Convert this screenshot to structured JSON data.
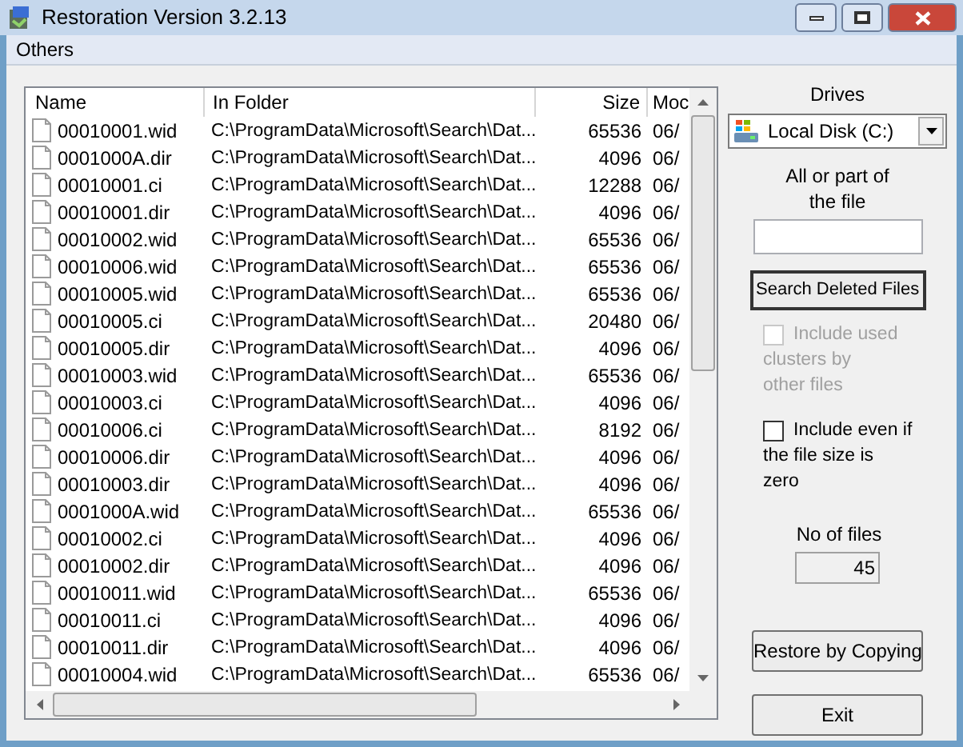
{
  "window": {
    "title": "Restoration Version 3.2.13"
  },
  "menu": [
    {
      "label": "Others"
    }
  ],
  "table": {
    "columns": [
      "Name",
      "In Folder",
      "Size",
      "Moc"
    ],
    "rows": [
      {
        "name": "00010001.wid",
        "folder": "C:\\ProgramData\\Microsoft\\Search\\Dat...",
        "size": "65536",
        "modified": "06/"
      },
      {
        "name": "0001000A.dir",
        "folder": "C:\\ProgramData\\Microsoft\\Search\\Dat...",
        "size": "4096",
        "modified": "06/"
      },
      {
        "name": "00010001.ci",
        "folder": "C:\\ProgramData\\Microsoft\\Search\\Dat...",
        "size": "12288",
        "modified": "06/"
      },
      {
        "name": "00010001.dir",
        "folder": "C:\\ProgramData\\Microsoft\\Search\\Dat...",
        "size": "4096",
        "modified": "06/"
      },
      {
        "name": "00010002.wid",
        "folder": "C:\\ProgramData\\Microsoft\\Search\\Dat...",
        "size": "65536",
        "modified": "06/"
      },
      {
        "name": "00010006.wid",
        "folder": "C:\\ProgramData\\Microsoft\\Search\\Dat...",
        "size": "65536",
        "modified": "06/"
      },
      {
        "name": "00010005.wid",
        "folder": "C:\\ProgramData\\Microsoft\\Search\\Dat...",
        "size": "65536",
        "modified": "06/"
      },
      {
        "name": "00010005.ci",
        "folder": "C:\\ProgramData\\Microsoft\\Search\\Dat...",
        "size": "20480",
        "modified": "06/"
      },
      {
        "name": "00010005.dir",
        "folder": "C:\\ProgramData\\Microsoft\\Search\\Dat...",
        "size": "4096",
        "modified": "06/"
      },
      {
        "name": "00010003.wid",
        "folder": "C:\\ProgramData\\Microsoft\\Search\\Dat...",
        "size": "65536",
        "modified": "06/"
      },
      {
        "name": "00010003.ci",
        "folder": "C:\\ProgramData\\Microsoft\\Search\\Dat...",
        "size": "4096",
        "modified": "06/"
      },
      {
        "name": "00010006.ci",
        "folder": "C:\\ProgramData\\Microsoft\\Search\\Dat...",
        "size": "8192",
        "modified": "06/"
      },
      {
        "name": "00010006.dir",
        "folder": "C:\\ProgramData\\Microsoft\\Search\\Dat...",
        "size": "4096",
        "modified": "06/"
      },
      {
        "name": "00010003.dir",
        "folder": "C:\\ProgramData\\Microsoft\\Search\\Dat...",
        "size": "4096",
        "modified": "06/"
      },
      {
        "name": "0001000A.wid",
        "folder": "C:\\ProgramData\\Microsoft\\Search\\Dat...",
        "size": "65536",
        "modified": "06/"
      },
      {
        "name": "00010002.ci",
        "folder": "C:\\ProgramData\\Microsoft\\Search\\Dat...",
        "size": "4096",
        "modified": "06/"
      },
      {
        "name": "00010002.dir",
        "folder": "C:\\ProgramData\\Microsoft\\Search\\Dat...",
        "size": "4096",
        "modified": "06/"
      },
      {
        "name": "00010011.wid",
        "folder": "C:\\ProgramData\\Microsoft\\Search\\Dat...",
        "size": "65536",
        "modified": "06/"
      },
      {
        "name": "00010011.ci",
        "folder": "C:\\ProgramData\\Microsoft\\Search\\Dat...",
        "size": "4096",
        "modified": "06/"
      },
      {
        "name": "00010011.dir",
        "folder": "C:\\ProgramData\\Microsoft\\Search\\Dat...",
        "size": "4096",
        "modified": "06/"
      },
      {
        "name": "00010004.wid",
        "folder": "C:\\ProgramData\\Microsoft\\Search\\Dat...",
        "size": "65536",
        "modified": "06/"
      }
    ]
  },
  "drives": {
    "label": "Drives",
    "value": "Local Disk (C:)"
  },
  "file_filter": {
    "label_lines": [
      "All or part of",
      "the file"
    ]
  },
  "search_button": "Search Deleted Files",
  "options": [
    {
      "label_lines": [
        "Include used",
        "clusters by",
        "other files"
      ],
      "checked": false,
      "disabled": true
    },
    {
      "label_lines": [
        "Include even if",
        "the file size is",
        "zero"
      ],
      "checked": false,
      "disabled": false
    }
  ],
  "file_count": {
    "label": "No of files",
    "value": "45"
  },
  "buttons": [
    "Restore by Copying",
    "Exit"
  ]
}
